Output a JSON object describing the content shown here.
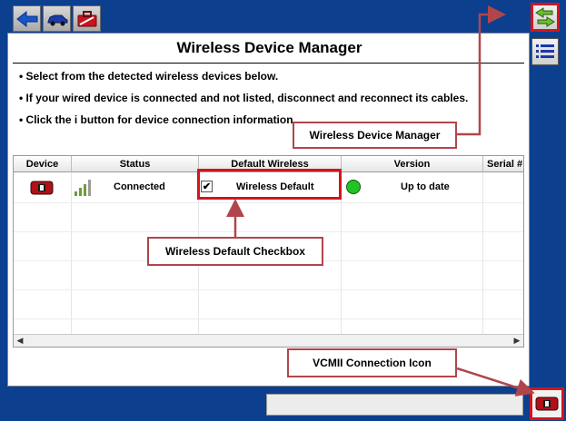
{
  "window": {
    "title": "Wireless Device Manager"
  },
  "toolbar": {
    "buttons": [
      {
        "name": "back",
        "icon": "back-arrow-icon"
      },
      {
        "name": "vehicle",
        "icon": "car-icon"
      },
      {
        "name": "toolbox",
        "icon": "toolbox-icon"
      }
    ]
  },
  "instructions": [
    "• Select from the detected wireless devices below.",
    "• If your wired device is connected and not listed, disconnect and reconnect its cables.",
    "• Click the i button for device connection information."
  ],
  "table": {
    "columns": [
      "Device",
      "Status",
      "Default Wireless",
      "Version",
      "Serial #"
    ],
    "rows": [
      {
        "device_icon": "vcm-device-icon",
        "signal_icon": "signal-strength-icon",
        "status": "Connected",
        "default_checked": true,
        "default_label": "Wireless Default",
        "version_indicator": "green-status-icon",
        "version": "Up to date",
        "serial": ""
      }
    ]
  },
  "sidebar": {
    "buttons": [
      {
        "name": "switch",
        "icon": "swap-arrows-icon"
      },
      {
        "name": "menu",
        "icon": "list-icon"
      }
    ]
  },
  "status_bar": {
    "text": "",
    "connection_icon": "vcm-connection-icon"
  },
  "callouts": {
    "wdm": "Wireless Device Manager",
    "checkbox": "Wireless Default Checkbox",
    "vcm": "VCMII Connection Icon"
  },
  "colors": {
    "background": "#0d3f8f",
    "highlight": "#d4141c",
    "callout_border": "#b0464c",
    "status_ok": "#22c322"
  }
}
